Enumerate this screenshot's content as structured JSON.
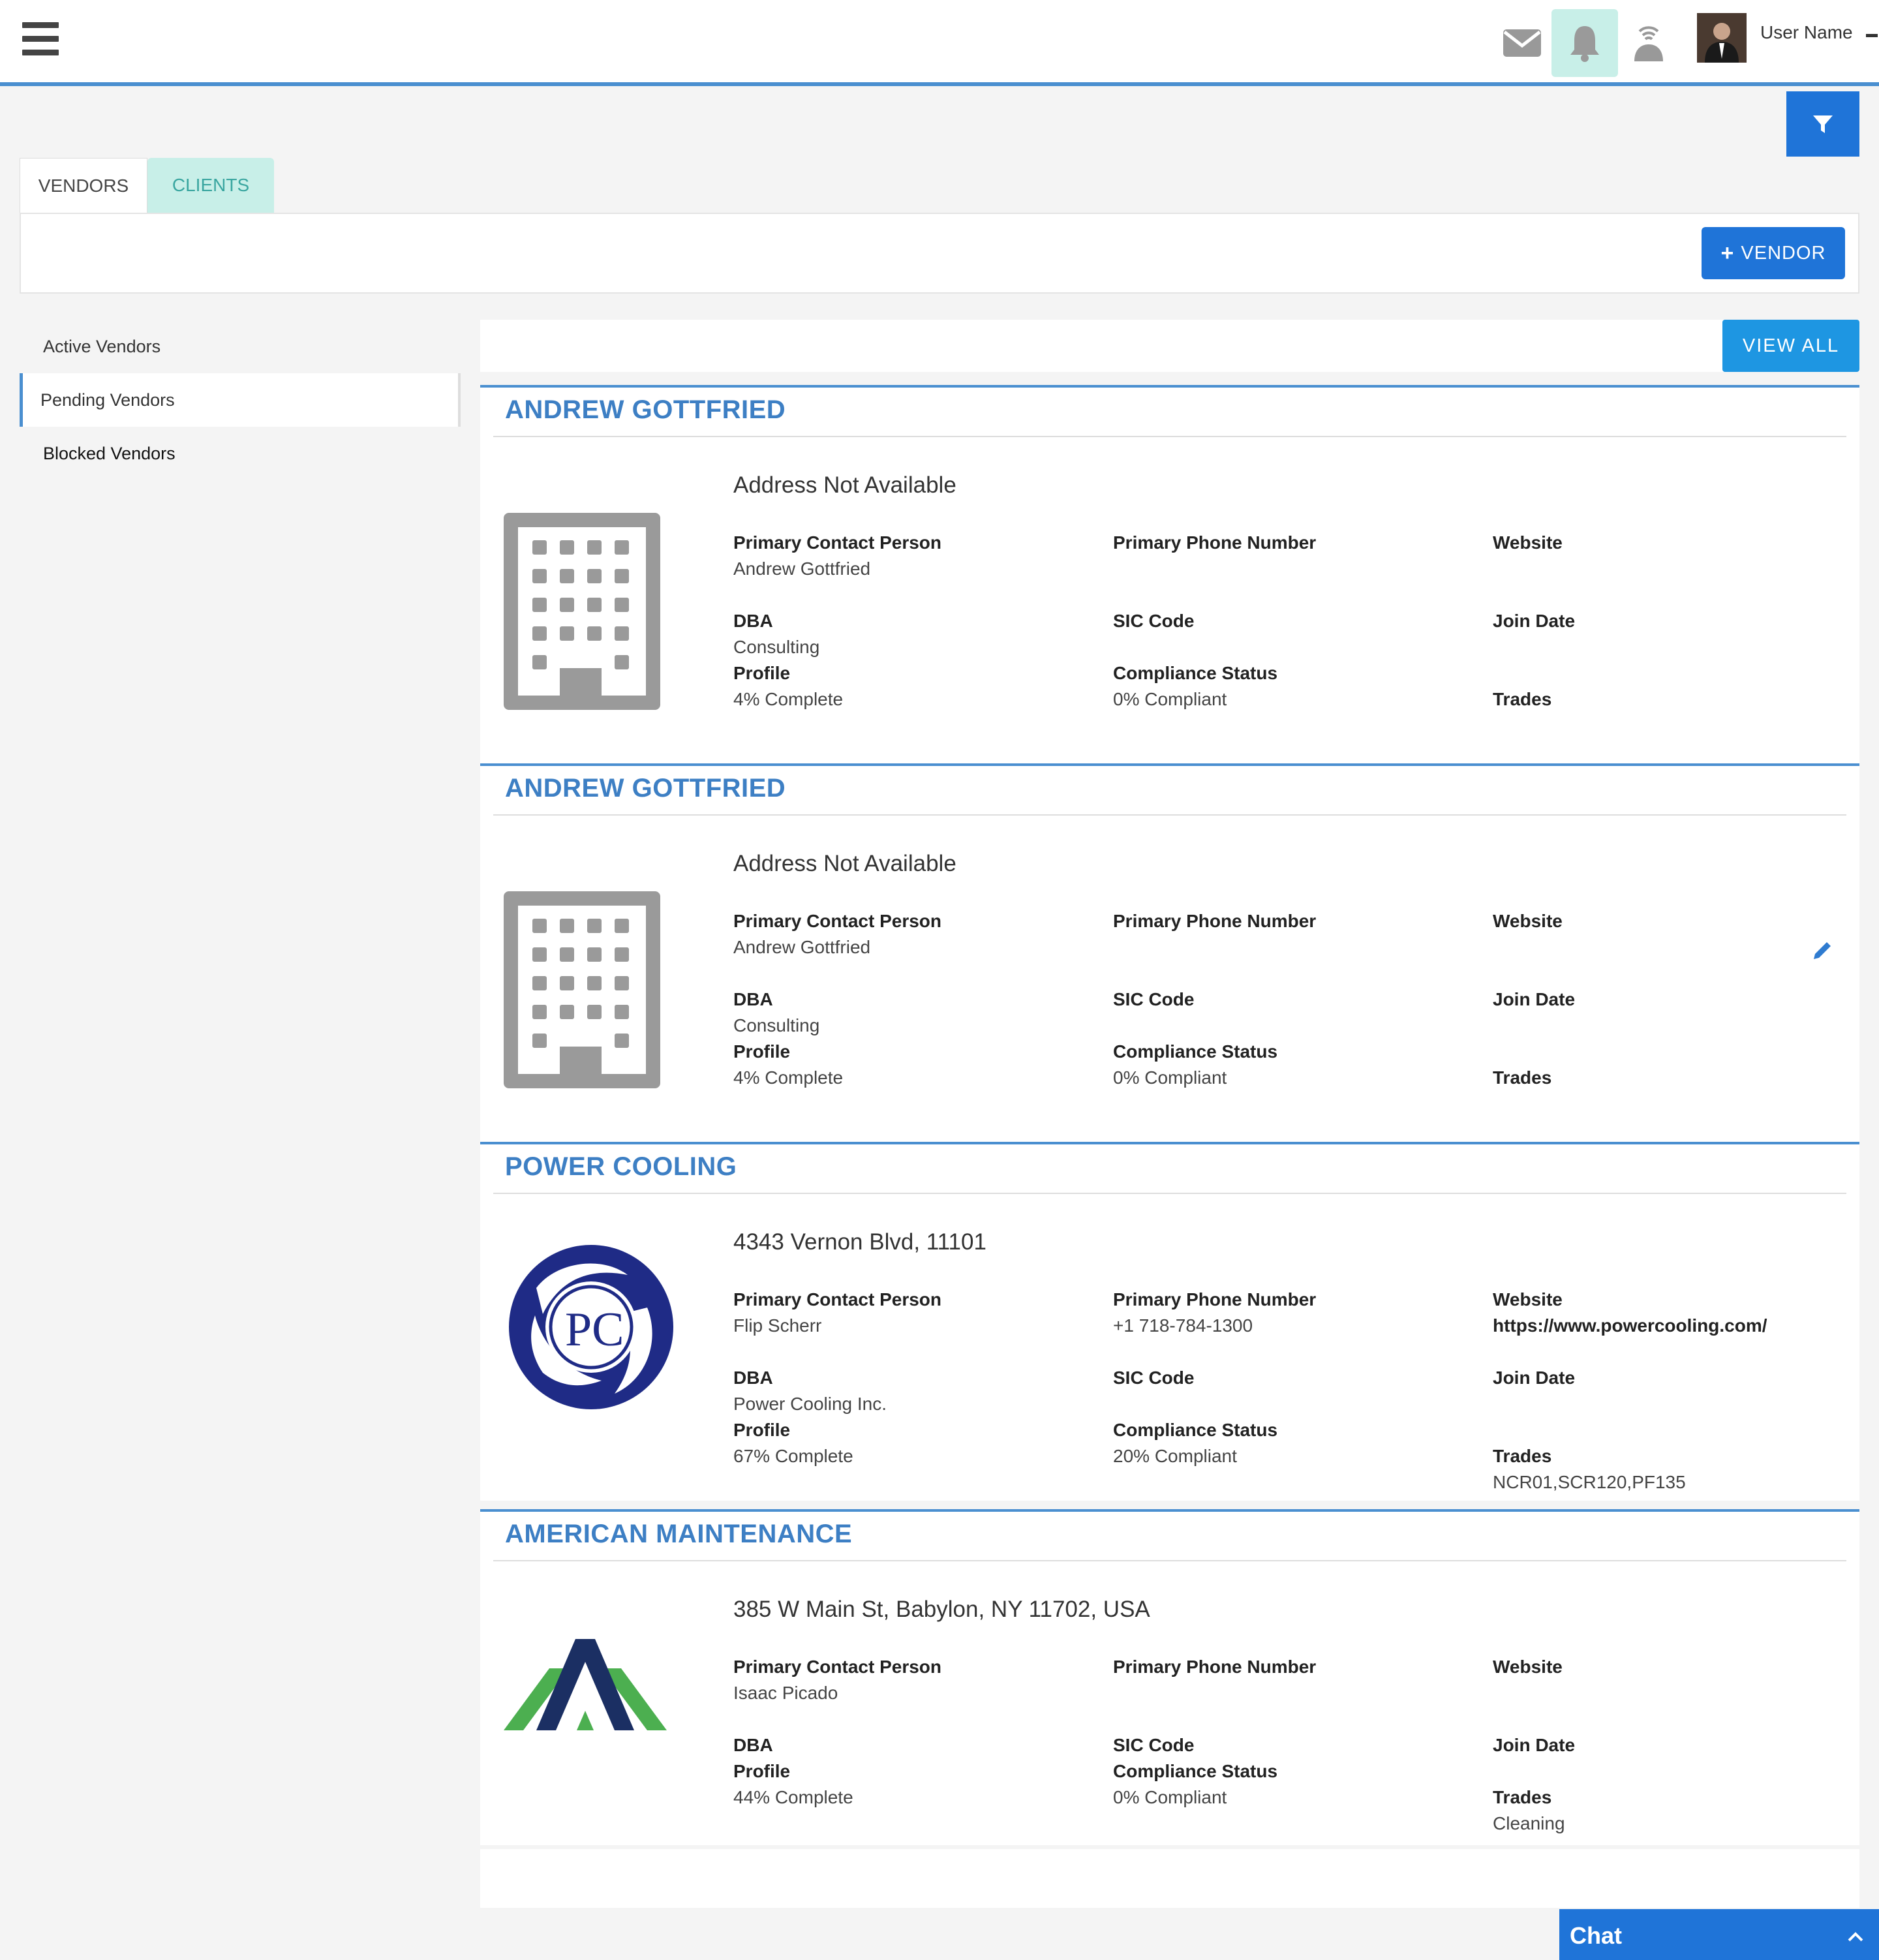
{
  "header": {
    "user_name": "User Name",
    "icons": [
      "menu-icon",
      "mail-icon",
      "bell-icon",
      "signal-icon",
      "filter-icon"
    ]
  },
  "tabs": [
    {
      "label": "VENDORS"
    },
    {
      "label": "CLIENTS"
    }
  ],
  "toolbar": {
    "add_vendor_label": "VENDOR"
  },
  "sidebar": {
    "items": [
      {
        "label": "Active Vendors"
      },
      {
        "label": "Pending Vendors"
      },
      {
        "label": "Blocked Vendors"
      }
    ]
  },
  "list": {
    "view_all_label": "VIEW ALL"
  },
  "labels": {
    "contact": "Primary Contact Person",
    "phone": "Primary Phone Number",
    "website": "Website",
    "dba": "DBA",
    "sic": "SIC Code",
    "join": "Join Date",
    "profile": "Profile",
    "compliance": "Compliance Status",
    "trades": "Trades"
  },
  "vendors": [
    {
      "name": "ANDREW GOTTFRIED",
      "address": "Address Not Available",
      "contact": "Andrew Gottfried",
      "phone": "",
      "website": "",
      "dba": "Consulting",
      "sic": "",
      "join": "",
      "profile": "4% Complete",
      "compliance": "0% Compliant",
      "trades": "",
      "logo": "building-icon"
    },
    {
      "name": "ANDREW GOTTFRIED",
      "address": "Address Not Available",
      "contact": "Andrew Gottfried",
      "phone": "",
      "website": "",
      "dba": "Consulting",
      "sic": "",
      "join": "",
      "profile": "4% Complete",
      "compliance": "0% Compliant",
      "trades": "",
      "logo": "building-icon"
    },
    {
      "name": "POWER COOLING",
      "address": "4343 Vernon Blvd, 11101",
      "contact": "Flip Scherr",
      "phone": "+1 718-784-1300",
      "website": "https://www.powercooling.com/",
      "dba": "Power Cooling Inc.",
      "sic": "",
      "join": "",
      "profile": "67% Complete",
      "compliance": "20% Compliant",
      "trades": "NCR01,SCR120,PF135",
      "logo": "power-cooling-logo",
      "logo_text": "PC"
    },
    {
      "name": "AMERICAN MAINTENANCE",
      "address": "385 W Main St, Babylon, NY 11702, USA",
      "contact": "Isaac Picado",
      "phone": "",
      "website": "",
      "dba": "",
      "sic": "",
      "join": "",
      "profile": "44% Complete",
      "compliance": "0% Compliant",
      "trades": "Cleaning",
      "logo": "american-maintenance-logo"
    }
  ],
  "chat": {
    "label": "Chat"
  },
  "colors": {
    "brand_blue": "#1f74d8",
    "title_blue": "#3d7fc4",
    "accent_teal": "#c8efe8"
  }
}
